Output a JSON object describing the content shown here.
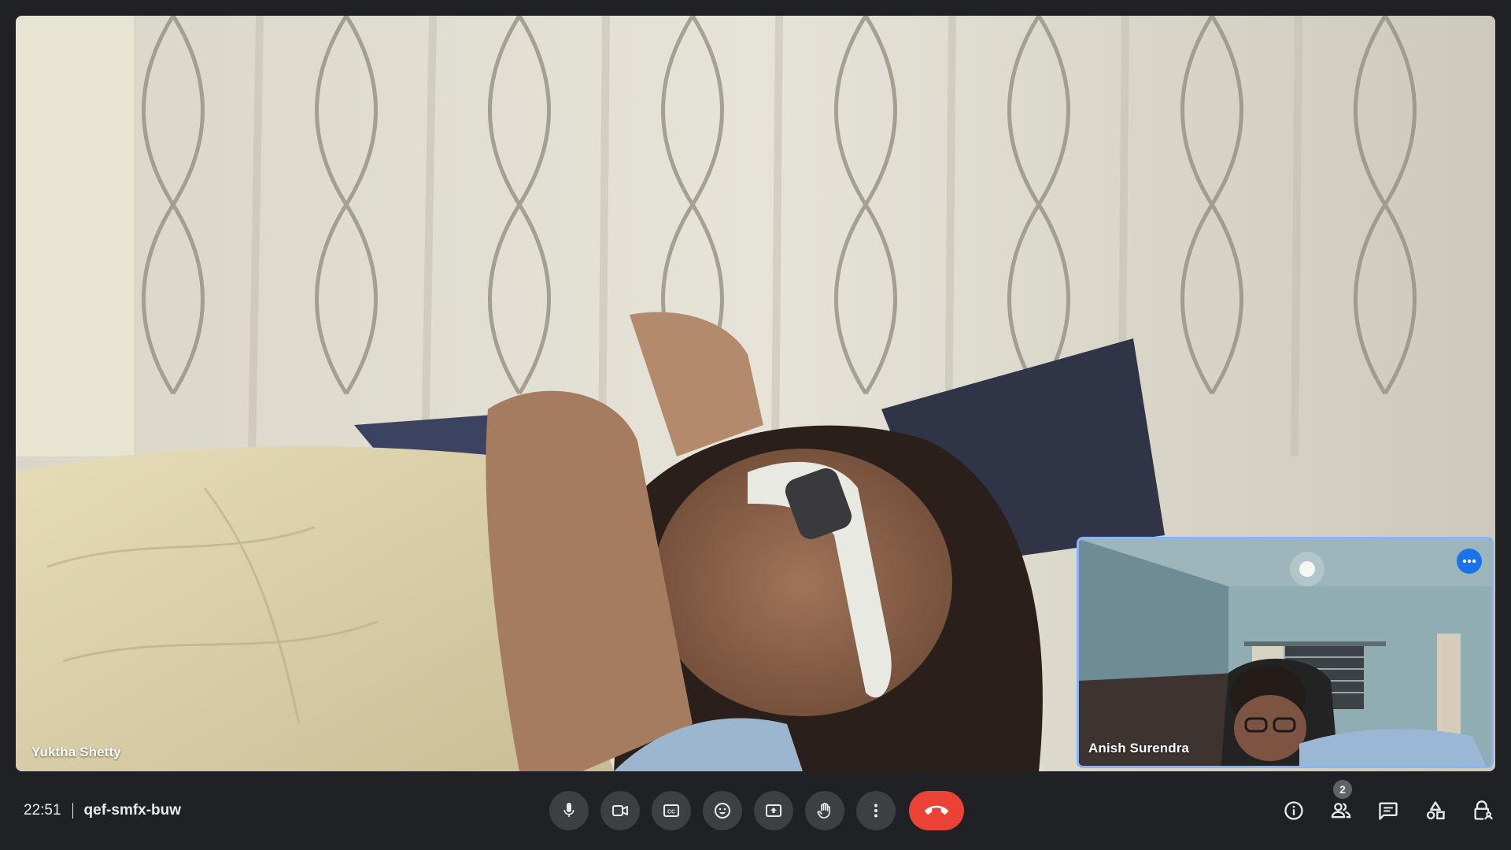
{
  "main_video": {
    "participant_name": "Yuktha Shetty"
  },
  "self_view": {
    "participant_name": "Anish Surendra",
    "more_options_icon": "more-horiz-icon",
    "border_color": "#8ab4f8"
  },
  "meeting": {
    "time": "22:51",
    "code": "qef-smfx-buw"
  },
  "controls": [
    {
      "name": "microphone",
      "icon": "mic-icon"
    },
    {
      "name": "camera",
      "icon": "videocam-icon"
    },
    {
      "name": "captions",
      "icon": "closed-caption-icon"
    },
    {
      "name": "reactions",
      "icon": "emoji-icon"
    },
    {
      "name": "present",
      "icon": "present-to-all-icon"
    },
    {
      "name": "raise-hand",
      "icon": "hand-icon"
    },
    {
      "name": "more-options",
      "icon": "more-vert-icon"
    },
    {
      "name": "leave-call",
      "icon": "call-end-icon"
    }
  ],
  "side_controls": {
    "participants_count": "2",
    "items": [
      {
        "name": "meeting-details",
        "icon": "info-icon"
      },
      {
        "name": "people",
        "icon": "people-icon"
      },
      {
        "name": "chat",
        "icon": "chat-icon"
      },
      {
        "name": "activities",
        "icon": "shapes-icon"
      },
      {
        "name": "host-controls",
        "icon": "lock-person-icon"
      }
    ]
  },
  "colors": {
    "background": "#202124",
    "control_button": "#3c4043",
    "hangup": "#ea4335",
    "accent": "#1a73e8"
  }
}
